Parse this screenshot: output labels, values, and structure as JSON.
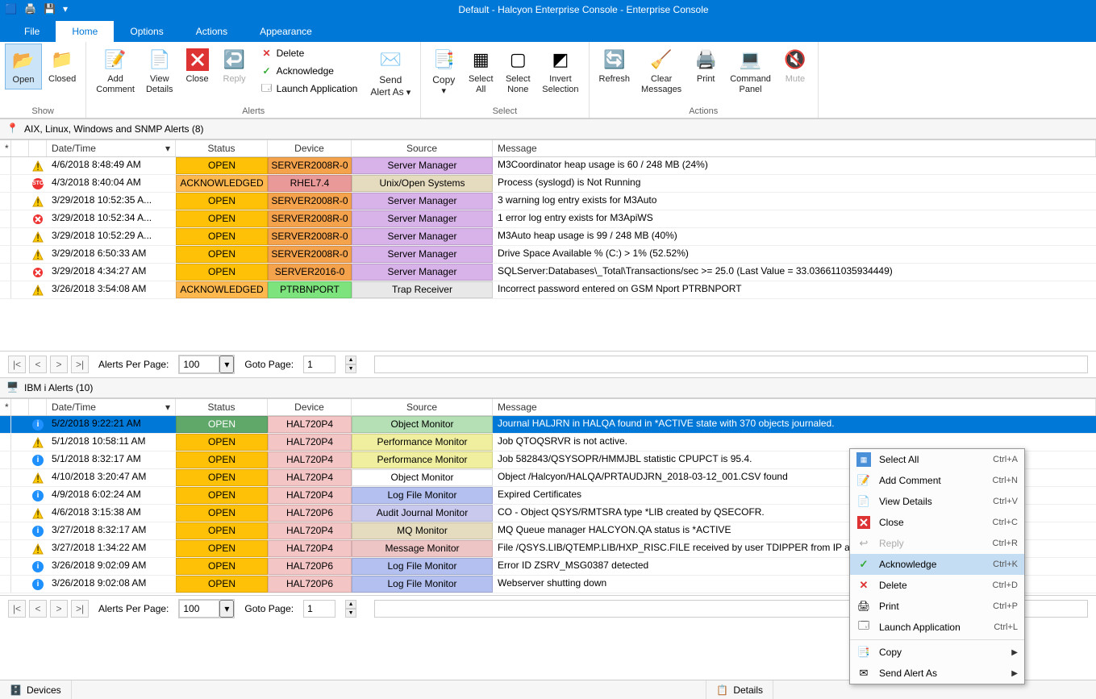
{
  "window": {
    "title": "Default - Halcyon Enterprise Console - Enterprise Console"
  },
  "menu": {
    "file": "File",
    "home": "Home",
    "options": "Options",
    "actions": "Actions",
    "appearance": "Appearance"
  },
  "ribbon": {
    "groups": {
      "show": "Show",
      "alerts": "Alerts",
      "select": "Select",
      "actions": "Actions"
    },
    "open": "Open",
    "closed": "Closed",
    "add_comment": "Add\nComment",
    "view_details": "View\nDetails",
    "close": "Close",
    "reply": "Reply",
    "delete": "Delete",
    "acknowledge": "Acknowledge",
    "launch_app": "Launch Application",
    "send_alert_as": "Send\nAlert As",
    "copy": "Copy",
    "select_all": "Select\nAll",
    "select_none": "Select\nNone",
    "invert_selection": "Invert\nSelection",
    "refresh": "Refresh",
    "clear_messages": "Clear\nMessages",
    "print": "Print",
    "command_panel": "Command\nPanel",
    "mute": "Mute"
  },
  "panel1": {
    "title": "AIX, Linux, Windows and SNMP Alerts (8)"
  },
  "panel2": {
    "title": "IBM i Alerts (10)"
  },
  "columns": {
    "datetime": "Date/Time",
    "status": "Status",
    "device": "Device",
    "source": "Source",
    "message": "Message"
  },
  "alerts1": [
    {
      "icon": "warn",
      "dt": "4/6/2018 8:48:49 AM",
      "status": "OPEN",
      "statusCls": "st-open",
      "device": "SERVER2008R-0",
      "deviceCls": "dv-orange",
      "source": "Server Manager",
      "sourceCls": "sc-purple",
      "msg": "M3Coordinator heap usage is 60 / 248 MB (24%)"
    },
    {
      "icon": "stop",
      "dt": "4/3/2018 8:40:04 AM",
      "status": "ACKNOWLEDGED",
      "statusCls": "st-ack",
      "device": "RHEL7.4",
      "deviceCls": "dv-red",
      "source": "Unix/Open Systems",
      "sourceCls": "sc-tan",
      "msg": "Process (syslogd) is Not Running"
    },
    {
      "icon": "warn",
      "dt": "3/29/2018 10:52:35 A...",
      "status": "OPEN",
      "statusCls": "st-open",
      "device": "SERVER2008R-0",
      "deviceCls": "dv-orange",
      "source": "Server Manager",
      "sourceCls": "sc-purple",
      "msg": "3 warning log entry exists for M3Auto"
    },
    {
      "icon": "err",
      "dt": "3/29/2018 10:52:34 A...",
      "status": "OPEN",
      "statusCls": "st-open",
      "device": "SERVER2008R-0",
      "deviceCls": "dv-orange",
      "source": "Server Manager",
      "sourceCls": "sc-purple",
      "msg": "1 error log entry exists for M3ApiWS"
    },
    {
      "icon": "warn",
      "dt": "3/29/2018 10:52:29 A...",
      "status": "OPEN",
      "statusCls": "st-open",
      "device": "SERVER2008R-0",
      "deviceCls": "dv-orange",
      "source": "Server Manager",
      "sourceCls": "sc-purple",
      "msg": "M3Auto heap usage is 99 / 248 MB (40%)"
    },
    {
      "icon": "warn",
      "dt": "3/29/2018 6:50:33 AM",
      "status": "OPEN",
      "statusCls": "st-open",
      "device": "SERVER2008R-0",
      "deviceCls": "dv-orange",
      "source": "Server Manager",
      "sourceCls": "sc-purple",
      "msg": "Drive Space Available % (C:) > 1% (52.52%)"
    },
    {
      "icon": "err",
      "dt": "3/29/2018 4:34:27 AM",
      "status": "OPEN",
      "statusCls": "st-open",
      "device": "SERVER2016-0",
      "deviceCls": "dv-orange",
      "source": "Server Manager",
      "sourceCls": "sc-purple",
      "msg": "SQLServer:Databases\\_Total\\Transactions/sec >= 25.0 (Last Value = 33.036611035934449)"
    },
    {
      "icon": "warn",
      "dt": "3/26/2018 3:54:08 AM",
      "status": "ACKNOWLEDGED",
      "statusCls": "st-ack",
      "device": "PTRBNPORT",
      "deviceCls": "dv-green",
      "source": "Trap Receiver",
      "sourceCls": "sc-grey",
      "msg": "Incorrect password entered on GSM Nport PTRBNPORT"
    }
  ],
  "alerts2": [
    {
      "icon": "info",
      "dt": "5/2/2018 9:22:21 AM",
      "status": "OPEN",
      "statusCls": "st-open-green",
      "device": "HAL720P4",
      "deviceCls": "dv-rose",
      "source": "Object Monitor",
      "sourceCls": "sc-green",
      "msg": "Journal HALJRN in HALQA found in *ACTIVE state with 370 objects journaled.",
      "selected": true
    },
    {
      "icon": "warn",
      "dt": "5/1/2018 10:58:11 AM",
      "status": "OPEN",
      "statusCls": "st-open",
      "device": "HAL720P4",
      "deviceCls": "dv-rose",
      "source": "Performance Monitor",
      "sourceCls": "sc-yellow",
      "msg": "Job QTOQSRVR is not active."
    },
    {
      "icon": "info",
      "dt": "5/1/2018 8:32:17 AM",
      "status": "OPEN",
      "statusCls": "st-open",
      "device": "HAL720P4",
      "deviceCls": "dv-rose",
      "source": "Performance Monitor",
      "sourceCls": "sc-yellow",
      "msg": "Job 582843/QSYSOPR/HMMJBL statistic CPUPCT is 95.4."
    },
    {
      "icon": "warn",
      "dt": "4/10/2018 3:20:47 AM",
      "status": "OPEN",
      "statusCls": "st-open",
      "device": "HAL720P4",
      "deviceCls": "dv-rose",
      "source": "Object Monitor",
      "sourceCls": "sc-white",
      "msg": "Object /Halcyon/HALQA/PRTAUDJRN_2018-03-12_001.CSV found"
    },
    {
      "icon": "info",
      "dt": "4/9/2018 6:02:24 AM",
      "status": "OPEN",
      "statusCls": "st-open",
      "device": "HAL720P4",
      "deviceCls": "dv-rose",
      "source": "Log File Monitor",
      "sourceCls": "sc-blue",
      "msg": "Expired Certificates"
    },
    {
      "icon": "warn",
      "dt": "4/6/2018 3:15:38 AM",
      "status": "OPEN",
      "statusCls": "st-open",
      "device": "HAL720P6",
      "deviceCls": "dv-rose",
      "source": "Audit Journal Monitor",
      "sourceCls": "sc-lav",
      "msg": "CO - Object QSYS/RMTSRA type *LIB created by QSECOFR."
    },
    {
      "icon": "info",
      "dt": "3/27/2018 8:32:17 AM",
      "status": "OPEN",
      "statusCls": "st-open",
      "device": "HAL720P4",
      "deviceCls": "dv-rose",
      "source": "MQ Monitor",
      "sourceCls": "sc-tan",
      "msg": "MQ Queue manager HALCYON.QA status is *ACTIVE"
    },
    {
      "icon": "warn",
      "dt": "3/27/2018 1:34:22 AM",
      "status": "OPEN",
      "statusCls": "st-open",
      "device": "HAL720P4",
      "deviceCls": "dv-rose",
      "source": "Message Monitor",
      "sourceCls": "sc-red",
      "msg": "File /QSYS.LIB/QTEMP.LIB/HXP_RISC.FILE received by user TDIPPER from IP ac"
    },
    {
      "icon": "info",
      "dt": "3/26/2018 9:02:09 AM",
      "status": "OPEN",
      "statusCls": "st-open",
      "device": "HAL720P6",
      "deviceCls": "dv-rose",
      "source": "Log File Monitor",
      "sourceCls": "sc-blue",
      "msg": "Error ID ZSRV_MSG0387 detected"
    },
    {
      "icon": "info",
      "dt": "3/26/2018 9:02:08 AM",
      "status": "OPEN",
      "statusCls": "st-open",
      "device": "HAL720P6",
      "deviceCls": "dv-rose",
      "source": "Log File Monitor",
      "sourceCls": "sc-blue",
      "msg": "Webserver shutting down"
    }
  ],
  "pager": {
    "alerts_per_page_label": "Alerts Per Page:",
    "alerts_per_page": "100",
    "goto_label": "Goto Page:",
    "goto": "1"
  },
  "contextmenu": {
    "select_all": "Select All",
    "sc_select_all": "Ctrl+A",
    "add_comment": "Add Comment",
    "sc_add_comment": "Ctrl+N",
    "view_details": "View Details",
    "sc_view_details": "Ctrl+V",
    "close": "Close",
    "sc_close": "Ctrl+C",
    "reply": "Reply",
    "sc_reply": "Ctrl+R",
    "acknowledge": "Acknowledge",
    "sc_acknowledge": "Ctrl+K",
    "delete": "Delete",
    "sc_delete": "Ctrl+D",
    "print": "Print",
    "sc_print": "Ctrl+P",
    "launch_app": "Launch Application",
    "sc_launch_app": "Ctrl+L",
    "copy": "Copy",
    "send_alert_as": "Send Alert As"
  },
  "bottom": {
    "devices": "Devices",
    "details": "Details"
  }
}
